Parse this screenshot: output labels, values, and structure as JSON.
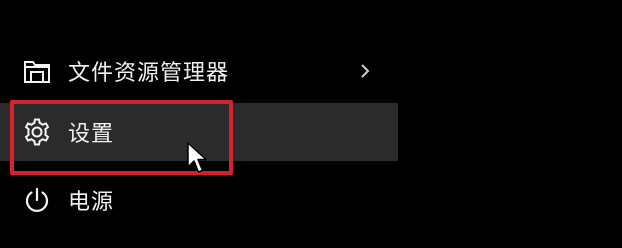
{
  "start_menu": {
    "items": [
      {
        "label": "文件资源管理器",
        "icon": "folder-explorer-icon",
        "has_submenu": true
      },
      {
        "label": "设置",
        "icon": "gear-icon",
        "has_submenu": false,
        "hovered": true
      },
      {
        "label": "电源",
        "icon": "power-icon",
        "has_submenu": false
      }
    ]
  },
  "annotation": {
    "highlight_color": "#d8202a"
  },
  "colors": {
    "background": "#000000",
    "hover_background": "#2b2b2b",
    "text": "#f2f2f2"
  }
}
